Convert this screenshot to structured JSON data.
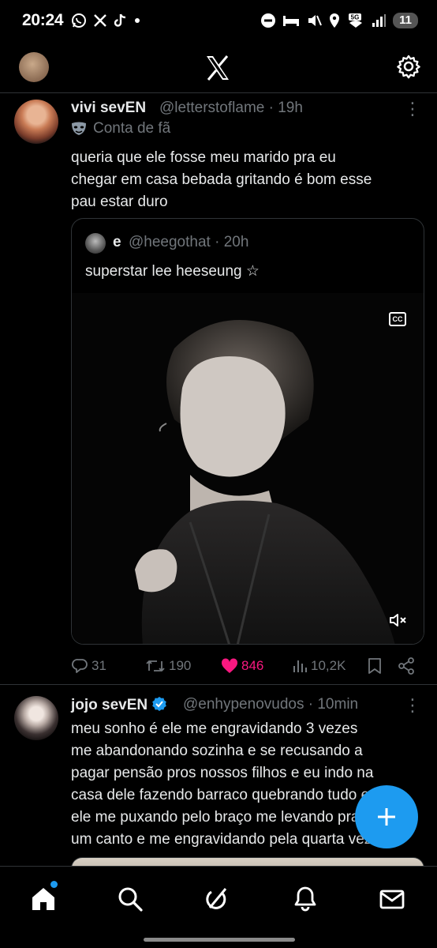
{
  "status_bar": {
    "time": "20:24",
    "network": "5G",
    "battery": "11"
  },
  "header": {
    "logo": "x-logo-icon",
    "settings": "gear-icon"
  },
  "tweet1": {
    "name": "vivi sevEN",
    "handle": "@letterstoflame",
    "time": "· 19h",
    "label": "Conta de fã",
    "body": [
      "queria que ele fosse meu marido pra eu",
      "chegar em casa bebada gritando é bom esse",
      "pau estar duro"
    ],
    "quote": {
      "name": "e",
      "handle": "@heegothat",
      "time": "· 20h",
      "text": "superstar lee heeseung ☆",
      "cc": "CC"
    },
    "actions": {
      "replies": "31",
      "reposts": "190",
      "likes": "846",
      "views": "10,2K"
    }
  },
  "tweet2": {
    "name": "jojo sevEN",
    "handle": "@enhypenovudos",
    "time": "· 10min",
    "body": [
      "meu sonho é ele me engravidando 3 vezes",
      "me abandonando sozinha e se recusando a",
      "pagar pensão pros nossos filhos e eu indo na",
      "casa dele fazendo barraco quebrando tudo e",
      "ele me puxando pelo braço me levando pra",
      "um canto e me engravidando pela quarta vez."
    ]
  },
  "colors": {
    "accent": "#1d9bf0",
    "like": "#f91880",
    "muted": "#71767b"
  }
}
